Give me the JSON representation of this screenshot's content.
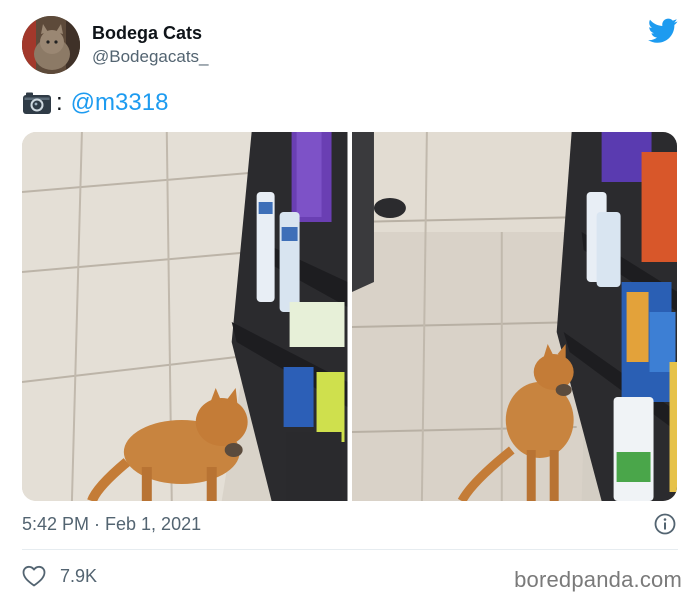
{
  "author": {
    "display_name": "Bodega Cats",
    "handle": "@Bodegacats_",
    "avatar_icon": "cat-avatar"
  },
  "brand": {
    "logo_icon": "twitter-bird-icon",
    "color": "#1d9bf0"
  },
  "tweet": {
    "camera_icon": "camera-icon",
    "colon": ":",
    "mention": "@m3318",
    "timestamp": "5:42 PM · Feb 1, 2021"
  },
  "media": {
    "photos": [
      {
        "subject": "orange cat carrying a mouse in a store aisle"
      },
      {
        "subject": "orange cat carrying a mouse beside store shelves"
      }
    ]
  },
  "engagement": {
    "like_icon": "heart-icon",
    "likes": "7.9K",
    "info_icon": "info-icon"
  },
  "watermark": "boredpanda.com",
  "colors": {
    "text_primary": "#0f1419",
    "text_secondary": "#536471",
    "link": "#1d9bf0",
    "divider": "#e6ecf0"
  }
}
